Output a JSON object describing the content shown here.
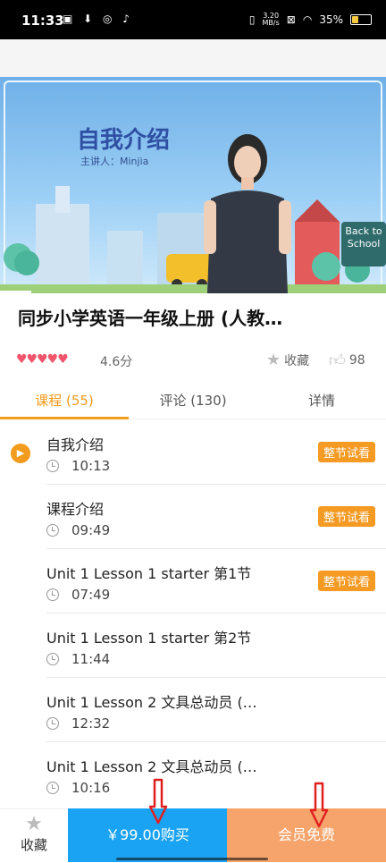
{
  "status_bar": {
    "time": "11:33",
    "speed_value": "3.20",
    "speed_unit": "MB/s",
    "battery": "35%"
  },
  "video": {
    "slide_title": "自我介绍",
    "presenter": "主讲人：Minjia",
    "sign_line1": "Back to",
    "sign_line2": "School",
    "progress_fraction": 0.08
  },
  "course": {
    "title": "同步小学英语一年级上册 (人教…",
    "rating_hearts": "♥♥♥♥♥",
    "score": "4.6分",
    "favorite_label": "收藏",
    "likes": "98"
  },
  "tabs": [
    {
      "label": "课程 (55)",
      "active": true
    },
    {
      "label": "评论 (130)",
      "active": false
    },
    {
      "label": "详情",
      "active": false
    }
  ],
  "lessons": [
    {
      "name": "自我介绍",
      "duration": "10:13",
      "trial": "整节试看",
      "playing": true
    },
    {
      "name": "课程介绍",
      "duration": "09:49",
      "trial": "整节试看",
      "playing": false
    },
    {
      "name": "Unit 1 Lesson 1 starter 第1节",
      "duration": "07:49",
      "trial": "整节试看",
      "playing": false
    },
    {
      "name": "Unit 1 Lesson 1 starter 第2节",
      "duration": "11:44",
      "trial": "",
      "playing": false
    },
    {
      "name": "Unit 1 Lesson 2 文具总动员 (…",
      "duration": "12:32",
      "trial": "",
      "playing": false
    },
    {
      "name": "Unit 1 Lesson 2 文具总动员 (…",
      "duration": "10:16",
      "trial": "",
      "playing": false
    }
  ],
  "bottom_bar": {
    "favorite_label": "收藏",
    "buy_label": "￥99.00购买",
    "vip_label": "会员免费"
  },
  "colors": {
    "accent": "#f29b1d",
    "buy": "#1aa3f2",
    "vip": "#f6a46b",
    "annotation_arrow": "#e02020"
  }
}
